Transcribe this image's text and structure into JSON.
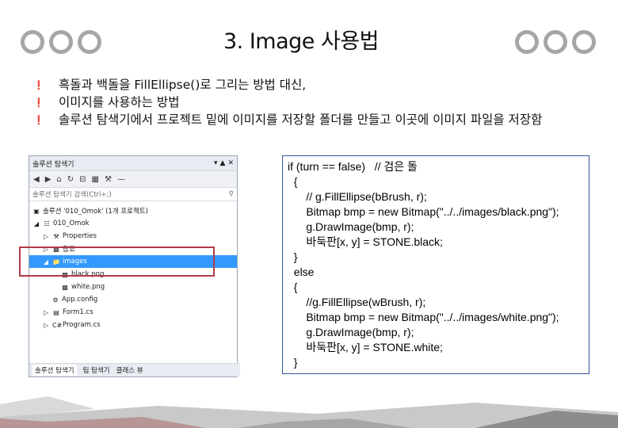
{
  "title": "3. Image 사용법",
  "bullets": [
    "흑돌과 백돌을 FillEllipse()로 그리는 방법 대신,",
    "이미지를 사용하는 방법",
    "솔루션 탐색기에서 프로젝트 밑에 이미지를 저장할 폴더를 만들고 이곳에 이미지 파일을 저장함"
  ],
  "explorer": {
    "title": "솔루션 탐색기",
    "search_placeholder": "솔루션 탐색기 검색(Ctrl+;)",
    "tree": [
      "솔루션 '010_Omok' (1개 프로젝트)",
      "010_Omok",
      "Properties",
      "참조",
      "images",
      "black.png",
      "white.png",
      "App.config",
      "Form1.cs",
      "Program.cs"
    ],
    "tabs": [
      "솔루션 탐색기",
      "팀 탐색기",
      "클래스 뷰"
    ]
  },
  "code": [
    "if (turn == false)   // 검은 돌",
    "  {",
    "      // g.FillEllipse(bBrush, r);",
    "      Bitmap bmp = new Bitmap(\"../../images/black.png\");",
    "      g.DrawImage(bmp, r);",
    "      바둑판[x, y] = STONE.black;",
    "  }",
    "  else",
    "  {",
    "      //g.FillEllipse(wBrush, r);",
    "      Bitmap bmp = new Bitmap(\"../../images/white.png\");",
    "      g.DrawImage(bmp, r);",
    "      바둑판[x, y] = STONE.white;",
    "  }"
  ]
}
